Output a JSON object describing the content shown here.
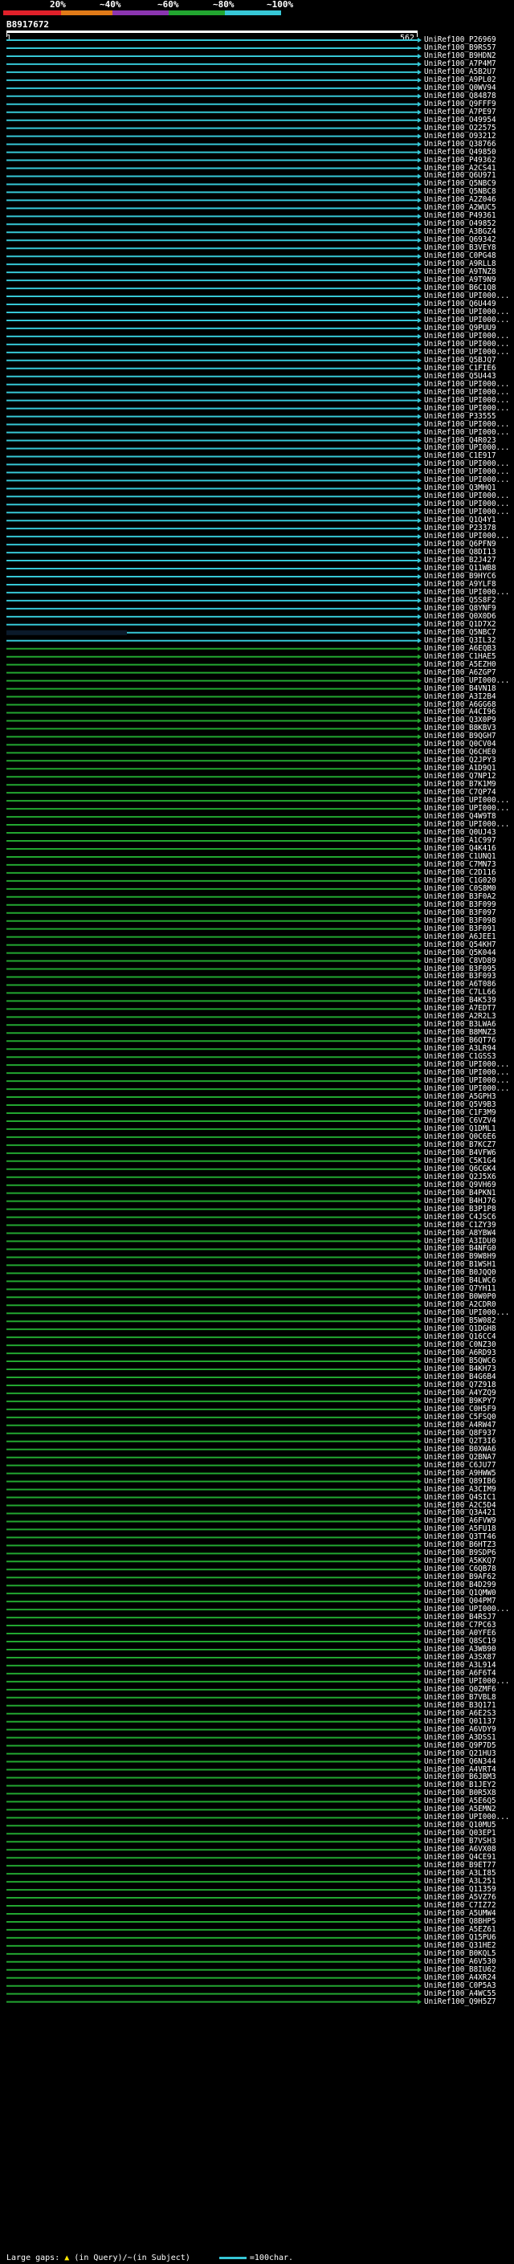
{
  "legend": {
    "labels": [
      "20%",
      "~40%",
      "~60%",
      "~80%",
      "~100%"
    ],
    "colors": [
      "#e0202a",
      "#e07a18",
      "#8b35b0",
      "#22a630",
      "#36c7d6"
    ]
  },
  "query": {
    "name": "B8917672",
    "start": "1",
    "end": "562"
  },
  "colors": {
    "identity_high": "#36c7d6",
    "identity_80": "#22a630",
    "gap": "#000000"
  },
  "hits": [
    "UniRef100_P26969",
    "UniRef100_B9RS57",
    "UniRef100_B9HDN2",
    "UniRef100_A7P4M7",
    "UniRef100_A5B2U7",
    "UniRef100_A9PL02",
    "UniRef100_Q0WV94",
    "UniRef100_Q84878",
    "UniRef100_Q9FFF9",
    "UniRef100_A7PE97",
    "UniRef100_O49954",
    "UniRef100_O22575",
    "UniRef100_O93212",
    "UniRef100_Q38766",
    "UniRef100_Q49850",
    "UniRef100_P49362",
    "UniRef100_A2CS41",
    "UniRef100_Q6U971",
    "UniRef100_Q5NBC9",
    "UniRef100_Q5NBC8",
    "UniRef100_A2Z046",
    "UniRef100_A2WUC5",
    "UniRef100_P49361",
    "UniRef100_O49852",
    "UniRef100_A3BGZ4",
    "UniRef100_Q69342",
    "UniRef100_B3VEY8",
    "UniRef100_C0PG48",
    "UniRef100_A9RLL8",
    "UniRef100_A9TNZ8",
    "UniRef100_A9T9N9",
    "UniRef100_B6C1Q8",
    "UniRef100_UPI000...",
    "UniRef100_Q6U449",
    "UniRef100_UPI000...",
    "UniRef100_UPI000...",
    "UniRef100_Q9PUU9",
    "UniRef100_UPI000...",
    "UniRef100_UPI000...",
    "UniRef100_UPI000...",
    "UniRef100_Q5BJQ7",
    "UniRef100_C1FIE6",
    "UniRef100_Q5U443",
    "UniRef100_UPI000...",
    "UniRef100_UPI000...",
    "UniRef100_UPI000...",
    "UniRef100_UPI000...",
    "UniRef100_P33555",
    "UniRef100_UPI000...",
    "UniRef100_UPI000...",
    "UniRef100_Q4R023",
    "UniRef100_UPI000...",
    "UniRef100_C1E917",
    "UniRef100_UPI000...",
    "UniRef100_UPI000...",
    "UniRef100_UPI000...",
    "UniRef100_Q3MHQ1",
    "UniRef100_UPI000...",
    "UniRef100_UPI000...",
    "UniRef100_UPI000...",
    "UniRef100_Q1Q4Y1",
    "UniRef100_P23378",
    "UniRef100_UPI000...",
    "UniRef100_Q6PFN9",
    "UniRef100_Q8DI13",
    "UniRef100_B2J427",
    "UniRef100_Q11WB8",
    "UniRef100_B9HYC6",
    "UniRef100_A9YLF8",
    "UniRef100_UPI000...",
    "UniRef100_Q5S8F2",
    "UniRef100_Q8YNF9",
    "UniRef100_Q0X0D6",
    "UniRef100_Q1D7X2",
    "UniRef100_Q5NBC7",
    "UniRef100_Q3IL32",
    "UniRef100_A6EQB3",
    "UniRef100_C1HAE5",
    "UniRef100_A5EZH0",
    "UniRef100_A6ZGP7",
    "UniRef100_UPI000...",
    "UniRef100_B4VN18",
    "UniRef100_A3I2B4",
    "UniRef100_A6GG68",
    "UniRef100_A4CI96",
    "UniRef100_Q3X0P9",
    "UniRef100_B8KBV3",
    "UniRef100_B9QGH7",
    "UniRef100_Q0CV04",
    "UniRef100_Q6CHE0",
    "UniRef100_Q2JPY3",
    "UniRef100_A1D9Q1",
    "UniRef100_Q7NP12",
    "UniRef100_B7K1M9",
    "UniRef100_C7QP74",
    "UniRef100_UPI000...",
    "UniRef100_UPI000...",
    "UniRef100_Q4W9T8",
    "UniRef100_UPI000...",
    "UniRef100_Q0UJ43",
    "UniRef100_A1C997",
    "UniRef100_Q4K416",
    "UniRef100_C1UNQ1",
    "UniRef100_C7MN73",
    "UniRef100_C2D116",
    "UniRef100_C1G020",
    "UniRef100_C0S8M0",
    "UniRef100_B3F0A2",
    "UniRef100_B3F099",
    "UniRef100_B3F097",
    "UniRef100_B3F098",
    "UniRef100_B3F091",
    "UniRef100_A6JEE1",
    "UniRef100_Q54KH7",
    "UniRef100_Q5K044",
    "UniRef100_C8VD89",
    "UniRef100_B3F095",
    "UniRef100_B3F093",
    "UniRef100_A6T086",
    "UniRef100_C7LL66",
    "UniRef100_B4K539",
    "UniRef100_A7EDT7",
    "UniRef100_A2R2L3",
    "UniRef100_B3LWA6",
    "UniRef100_B8MNZ3",
    "UniRef100_B6QT76",
    "UniRef100_A3LR94",
    "UniRef100_C1GSS3",
    "UniRef100_UPI000...",
    "UniRef100_UPI000...",
    "UniRef100_UPI000...",
    "UniRef100_UPI000...",
    "UniRef100_A5GPH3",
    "UniRef100_Q5V9B3",
    "UniRef100_C1F3M9",
    "UniRef100_C6VZV4",
    "UniRef100_Q1DML1",
    "UniRef100_Q0C6E6",
    "UniRef100_B7KCZ7",
    "UniRef100_B4VFW6",
    "UniRef100_C5K1G4",
    "UniRef100_Q6CGK4",
    "UniRef100_Q2J5X6",
    "UniRef100_Q9VH69",
    "UniRef100_B4PKN1",
    "UniRef100_B4HJ76",
    "UniRef100_B3P1P8",
    "UniRef100_C4JSC6",
    "UniRef100_C1ZY39",
    "UniRef100_A8YBW4",
    "UniRef100_A3IDU0",
    "UniRef100_B4NFG0",
    "UniRef100_B9W8H9",
    "UniRef100_B1WSH1",
    "UniRef100_B0JQQ0",
    "UniRef100_B4LWC6",
    "UniRef100_Q7YH11",
    "UniRef100_B0W0P0",
    "UniRef100_A2CDR0",
    "UniRef100_UPI000...",
    "UniRef100_B5W082",
    "UniRef100_Q1DGH8",
    "UniRef100_Q16CC4",
    "UniRef100_C0NZ30",
    "UniRef100_A6RD93",
    "UniRef100_B5QWC6",
    "UniRef100_B4KH73",
    "UniRef100_B4G6B4",
    "UniRef100_Q7Z918",
    "UniRef100_A4YZQ9",
    "UniRef100_B9KPY7",
    "UniRef100_C0H5F9",
    "UniRef100_C5FSQ0",
    "UniRef100_A4RW47",
    "UniRef100_Q8F937",
    "UniRef100_Q2T3I6",
    "UniRef100_B0XWA6",
    "UniRef100_Q2BNA7",
    "UniRef100_C6JU77",
    "UniRef100_A9HWW5",
    "UniRef100_Q89IB6",
    "UniRef100_A3CIM9",
    "UniRef100_Q4SIC1",
    "UniRef100_A2C5D4",
    "UniRef100_Q3A421",
    "UniRef100_A6FVW9",
    "UniRef100_A5FU18",
    "UniRef100_Q3TT46",
    "UniRef100_B6HTZ3",
    "UniRef100_B9SDP6",
    "UniRef100_A5KKQ7",
    "UniRef100_C6QB78",
    "UniRef100_B9AF62",
    "UniRef100_B4D299",
    "UniRef100_Q1QMW0",
    "UniRef100_Q04PM7",
    "UniRef100_UPI000...",
    "UniRef100_B4RSJ7",
    "UniRef100_C7PC63",
    "UniRef100_A0YFE6",
    "UniRef100_Q8SC19",
    "UniRef100_A3WB90",
    "UniRef100_A3SX87",
    "UniRef100_A3L914",
    "UniRef100_A6F6T4",
    "UniRef100_UPI000...",
    "UniRef100_Q0ZMF6",
    "UniRef100_B7VBL8",
    "UniRef100_B3Q171",
    "UniRef100_A6E2S3",
    "UniRef100_Q01137",
    "UniRef100_A6VDY9",
    "UniRef100_A3DSS1",
    "UniRef100_Q9P7D5",
    "UniRef100_Q21HU3",
    "UniRef100_Q6N344",
    "UniRef100_A4VRT4",
    "UniRef100_B6JBM3",
    "UniRef100_B1JEY2",
    "UniRef100_B0R5X8",
    "UniRef100_A5E6Q5",
    "UniRef100_A5EMN2",
    "UniRef100_UPI000...",
    "UniRef100_Q10MU5",
    "UniRef100_Q03EP1",
    "UniRef100_B7VSH3",
    "UniRef100_A6VX08",
    "UniRef100_Q4CE91",
    "UniRef100_B9ET77",
    "UniRef100_A3LI85",
    "UniRef100_A3L251",
    "UniRef100_Q11359",
    "UniRef100_A5VZ76",
    "UniRef100_C7IZ72",
    "UniRef100_A5UMW4",
    "UniRef100_Q8BHP5",
    "UniRef100_A5EZ61",
    "UniRef100_Q15PU6",
    "UniRef100_Q31HE2",
    "UniRef100_B0KQL5",
    "UniRef100_A6V530",
    "UniRef100_B8IU62",
    "UniRef100_A4XR24",
    "UniRef100_C0P5A3",
    "UniRef100_A4WC55",
    "UniRef100_Q9H5Z7"
  ],
  "footer": {
    "label": "Large gaps:",
    "in_query": "(in Query)",
    "slash": "/",
    "in_subject": "~(in Subject)",
    "scale": "=100char."
  }
}
